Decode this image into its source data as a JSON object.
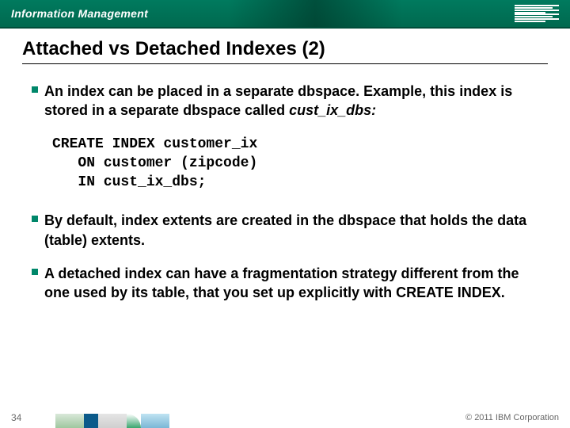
{
  "header": {
    "brand": "Information Management",
    "logo_label": "IBM"
  },
  "slide": {
    "title": "Attached vs Detached Indexes (2)"
  },
  "bullets": {
    "b1_pre": "An index can be placed in a separate dbspace. Example, this index is stored in a separate dbspace called ",
    "b1_code": "cust_ix_dbs:",
    "b2": "By default, index extents are created in the dbspace that holds the data (table) extents.",
    "b3": "A detached index can have a fragmentation strategy different from the one used by its table, that you set up explicitly with CREATE INDEX."
  },
  "code": "CREATE INDEX customer_ix\n   ON customer (zipcode)\n   IN cust_ix_dbs;",
  "footer": {
    "page": "34",
    "copyright": "© 2011 IBM Corporation"
  }
}
